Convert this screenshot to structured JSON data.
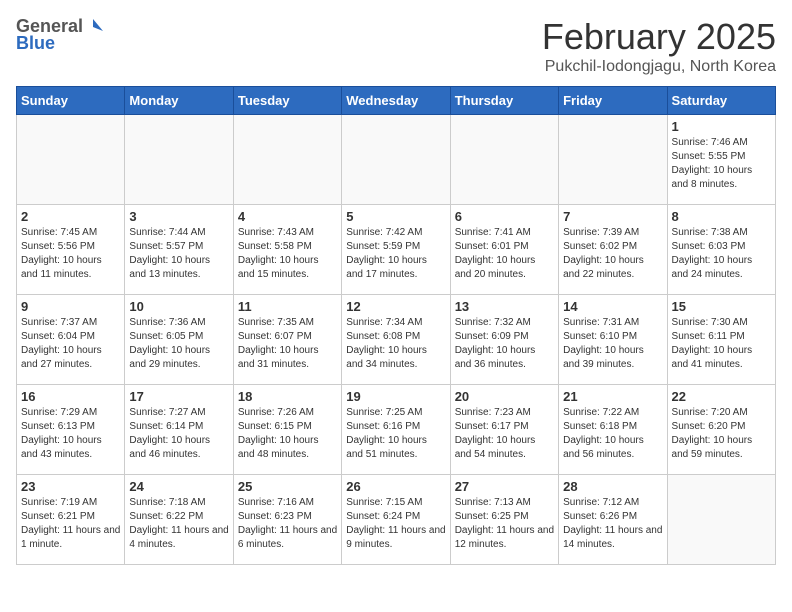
{
  "header": {
    "logo_general": "General",
    "logo_blue": "Blue",
    "title": "February 2025",
    "location": "Pukchil-Iodongjagu, North Korea"
  },
  "days_of_week": [
    "Sunday",
    "Monday",
    "Tuesday",
    "Wednesday",
    "Thursday",
    "Friday",
    "Saturday"
  ],
  "weeks": [
    [
      {
        "day": "",
        "info": ""
      },
      {
        "day": "",
        "info": ""
      },
      {
        "day": "",
        "info": ""
      },
      {
        "day": "",
        "info": ""
      },
      {
        "day": "",
        "info": ""
      },
      {
        "day": "",
        "info": ""
      },
      {
        "day": "1",
        "info": "Sunrise: 7:46 AM\nSunset: 5:55 PM\nDaylight: 10 hours and 8 minutes."
      }
    ],
    [
      {
        "day": "2",
        "info": "Sunrise: 7:45 AM\nSunset: 5:56 PM\nDaylight: 10 hours and 11 minutes."
      },
      {
        "day": "3",
        "info": "Sunrise: 7:44 AM\nSunset: 5:57 PM\nDaylight: 10 hours and 13 minutes."
      },
      {
        "day": "4",
        "info": "Sunrise: 7:43 AM\nSunset: 5:58 PM\nDaylight: 10 hours and 15 minutes."
      },
      {
        "day": "5",
        "info": "Sunrise: 7:42 AM\nSunset: 5:59 PM\nDaylight: 10 hours and 17 minutes."
      },
      {
        "day": "6",
        "info": "Sunrise: 7:41 AM\nSunset: 6:01 PM\nDaylight: 10 hours and 20 minutes."
      },
      {
        "day": "7",
        "info": "Sunrise: 7:39 AM\nSunset: 6:02 PM\nDaylight: 10 hours and 22 minutes."
      },
      {
        "day": "8",
        "info": "Sunrise: 7:38 AM\nSunset: 6:03 PM\nDaylight: 10 hours and 24 minutes."
      }
    ],
    [
      {
        "day": "9",
        "info": "Sunrise: 7:37 AM\nSunset: 6:04 PM\nDaylight: 10 hours and 27 minutes."
      },
      {
        "day": "10",
        "info": "Sunrise: 7:36 AM\nSunset: 6:05 PM\nDaylight: 10 hours and 29 minutes."
      },
      {
        "day": "11",
        "info": "Sunrise: 7:35 AM\nSunset: 6:07 PM\nDaylight: 10 hours and 31 minutes."
      },
      {
        "day": "12",
        "info": "Sunrise: 7:34 AM\nSunset: 6:08 PM\nDaylight: 10 hours and 34 minutes."
      },
      {
        "day": "13",
        "info": "Sunrise: 7:32 AM\nSunset: 6:09 PM\nDaylight: 10 hours and 36 minutes."
      },
      {
        "day": "14",
        "info": "Sunrise: 7:31 AM\nSunset: 6:10 PM\nDaylight: 10 hours and 39 minutes."
      },
      {
        "day": "15",
        "info": "Sunrise: 7:30 AM\nSunset: 6:11 PM\nDaylight: 10 hours and 41 minutes."
      }
    ],
    [
      {
        "day": "16",
        "info": "Sunrise: 7:29 AM\nSunset: 6:13 PM\nDaylight: 10 hours and 43 minutes."
      },
      {
        "day": "17",
        "info": "Sunrise: 7:27 AM\nSunset: 6:14 PM\nDaylight: 10 hours and 46 minutes."
      },
      {
        "day": "18",
        "info": "Sunrise: 7:26 AM\nSunset: 6:15 PM\nDaylight: 10 hours and 48 minutes."
      },
      {
        "day": "19",
        "info": "Sunrise: 7:25 AM\nSunset: 6:16 PM\nDaylight: 10 hours and 51 minutes."
      },
      {
        "day": "20",
        "info": "Sunrise: 7:23 AM\nSunset: 6:17 PM\nDaylight: 10 hours and 54 minutes."
      },
      {
        "day": "21",
        "info": "Sunrise: 7:22 AM\nSunset: 6:18 PM\nDaylight: 10 hours and 56 minutes."
      },
      {
        "day": "22",
        "info": "Sunrise: 7:20 AM\nSunset: 6:20 PM\nDaylight: 10 hours and 59 minutes."
      }
    ],
    [
      {
        "day": "23",
        "info": "Sunrise: 7:19 AM\nSunset: 6:21 PM\nDaylight: 11 hours and 1 minute."
      },
      {
        "day": "24",
        "info": "Sunrise: 7:18 AM\nSunset: 6:22 PM\nDaylight: 11 hours and 4 minutes."
      },
      {
        "day": "25",
        "info": "Sunrise: 7:16 AM\nSunset: 6:23 PM\nDaylight: 11 hours and 6 minutes."
      },
      {
        "day": "26",
        "info": "Sunrise: 7:15 AM\nSunset: 6:24 PM\nDaylight: 11 hours and 9 minutes."
      },
      {
        "day": "27",
        "info": "Sunrise: 7:13 AM\nSunset: 6:25 PM\nDaylight: 11 hours and 12 minutes."
      },
      {
        "day": "28",
        "info": "Sunrise: 7:12 AM\nSunset: 6:26 PM\nDaylight: 11 hours and 14 minutes."
      },
      {
        "day": "",
        "info": ""
      }
    ]
  ]
}
